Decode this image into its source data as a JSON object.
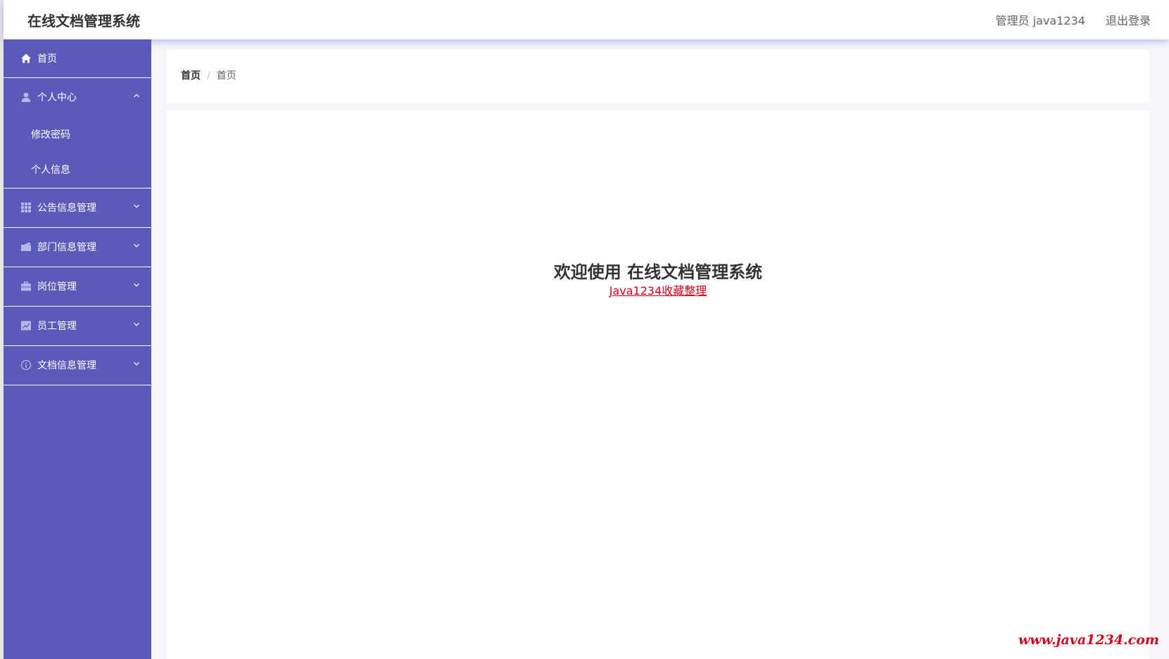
{
  "header": {
    "title": "在线文档管理系统",
    "user": "管理员 java1234",
    "logout": "退出登录"
  },
  "sidebar": {
    "items": [
      {
        "label": "首页",
        "icon": "home-icon"
      },
      {
        "label": "个人中心",
        "icon": "user-icon",
        "expanded": true,
        "children": [
          "修改密码",
          "个人信息"
        ]
      },
      {
        "label": "公告信息管理",
        "icon": "grid-icon"
      },
      {
        "label": "部门信息管理",
        "icon": "folder-icon"
      },
      {
        "label": "岗位管理",
        "icon": "briefcase-icon"
      },
      {
        "label": "员工管理",
        "icon": "chart-icon"
      },
      {
        "label": "文档信息管理",
        "icon": "info-icon"
      }
    ]
  },
  "breadcrumb": {
    "root": "首页",
    "separator": "/",
    "current": "首页"
  },
  "main": {
    "welcome_title": "欢迎使用 在线文档管理系统",
    "welcome_link": "Java1234收藏整理"
  },
  "watermark": "www.java1234.com",
  "colors": {
    "sidebar": "#5a5ab8",
    "accent_link": "#d0021b"
  }
}
